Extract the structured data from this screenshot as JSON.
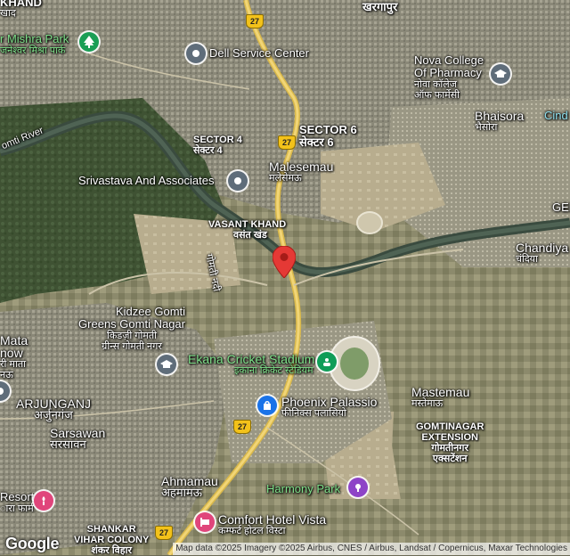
{
  "map": {
    "places": {
      "kharagpur": "खरगापुर",
      "top_left_khand": "KHAND",
      "top_left_khand_hi": "खंड",
      "mishra_park": "r Mishra Park",
      "mishra_park_hi": "जनेश्वर मिश्रा पार्क",
      "dell": "Dell Service Center",
      "nova_college": "Nova College",
      "nova_college_2": "Of Pharmacy",
      "nova_college_hi": "नोवा कॉलेज",
      "nova_college_hi_2": "ऑफ फार्मेसी",
      "bhaisora": "Bhaisora",
      "bhaisora_hi": "भैसोरा",
      "cind": "Cind",
      "sector6": "SECTOR 6",
      "sector6_hi": "सेक्टर 6",
      "sector4": "SECTOR 4",
      "sector4_hi": "सेक्टर 4",
      "gomti_river": "omti River",
      "malesemau": "Malesemau",
      "malesemau_hi": "मलेसेमऊ",
      "srivastava": "Srivastava And Associates",
      "gel": "GEL",
      "vasant_khand": "VASANT KHAND",
      "vasant_khand_hi": "वसंत खंड",
      "gomti_nadi_hi": "गोमती नदी",
      "chandiya": "Chandiya",
      "chandiya_hi": "चंदिया",
      "kidzee": "Kidzee Gomti",
      "kidzee_2": "Greens Gomti Nagar",
      "kidzee_hi": "किडज़ी गोमती",
      "kidzee_hi_2": "ग्रीन्स गोमती नगर",
      "ekana": "Ekana Cricket Stadium",
      "ekana_hi": "इकाना क्रिकेट स्टेडियम",
      "mata_1": "Mata",
      "mata_2": "now",
      "mata_hi": "री माता",
      "mata_hi_2": "नऊ",
      "arjunganj": "ARJUNGANJ",
      "arjunganj_hi": "अर्जुनगंज",
      "mastemau": "Mastemau",
      "mastemau_hi": "मस्तेमाऊ",
      "phoenix": "Phoenix Palassio",
      "phoenix_hi": "फीनिक्स पलासियो",
      "gomtinagar_ext": "GOMTINAGAR",
      "gomtinagar_ext_2": "EXTENSION",
      "gomtinagar_ext_hi": "गोमतीनगर",
      "gomtinagar_ext_hi_2": "एक्सटेंशन",
      "sarsawan": "Sarsawan",
      "sarsawan_hi": "सरसावन",
      "ahmamau": "Ahmamau",
      "ahmamau_hi": "अहमामऊ",
      "harmony": "Harmony Park",
      "resort": "Resort",
      "resort_hi": "ारा फार्म",
      "comfort": "Comfort Hotel Vista",
      "comfort_hi": "कम्फर्ट होटल विस्टा",
      "shankar": "SHANKAR",
      "shankar_2": "VIHAR COLONY",
      "shankar_hi": "शंकर विहार",
      "top_khad": "खाद"
    },
    "highway_shield": "27",
    "google_logo": "Google",
    "attribution": "Map data ©2025 Imagery ©2025 Airbus, CNES / Airbus, Landsat / Copernicus, Maxar Technologies",
    "colors": {
      "park_pin": "#1a9e55",
      "gray_pin": "#5f6d7a",
      "blue_pin": "#1a73e8",
      "purple_pin": "#8e44c7",
      "pink_pin": "#e0457b",
      "teal_pin": "#0f9d58",
      "marker_red": "#e53935",
      "highway": "#f3c21a"
    },
    "icons": {
      "park": "tree-icon",
      "dell": "shop-icon",
      "nova": "school-icon",
      "srivastava": "office-icon",
      "kidzee": "school-icon",
      "ekana": "stadium-icon",
      "phoenix": "shopping-bag-icon",
      "harmony": "park-icon",
      "resort": "resort-icon",
      "comfort": "hotel-icon",
      "marker": "location-marker-icon"
    }
  }
}
